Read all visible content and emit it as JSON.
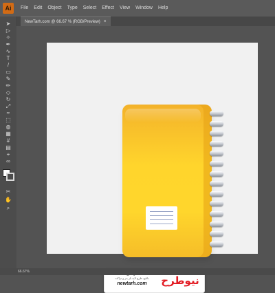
{
  "app": {
    "logo": "Ai"
  },
  "menu": [
    "File",
    "Edit",
    "Object",
    "Type",
    "Select",
    "Effect",
    "View",
    "Window",
    "Help"
  ],
  "document_tab": {
    "title": "NewTarh.com @ 66.67 % (RGB/Preview)",
    "close": "×"
  },
  "tools": [
    "select-icon",
    "direct-select-icon",
    "magic-wand-icon",
    "pen-icon",
    "curvature-icon",
    "type-icon",
    "line-icon",
    "rectangle-icon",
    "paintbrush-icon",
    "pencil-icon",
    "eraser-icon",
    "rotate-icon",
    "scale-icon",
    "width-icon",
    "free-transform-icon",
    "shape-builder-icon",
    "perspective-icon",
    "mesh-icon",
    "gradient-icon",
    "eyedropper-icon",
    "blend-icon",
    "symbol-sprayer-icon",
    "graph-icon",
    "artboard-icon",
    "slice-icon",
    "hand-icon",
    "zoom-icon"
  ],
  "colors": {
    "fill": "#ffffff",
    "stroke": "#dadada",
    "notebook": "#ffd62c",
    "ring": "#c9cdd4",
    "brand_red": "#e21b23"
  },
  "watermark": {
    "name": "نیوطرح",
    "subtitle": "دانلود طرح لایه باز بنر و تراکت",
    "url": "newtarh.com",
    "logo_text": "نیوطرح"
  },
  "status": {
    "zoom": "66.67%"
  }
}
